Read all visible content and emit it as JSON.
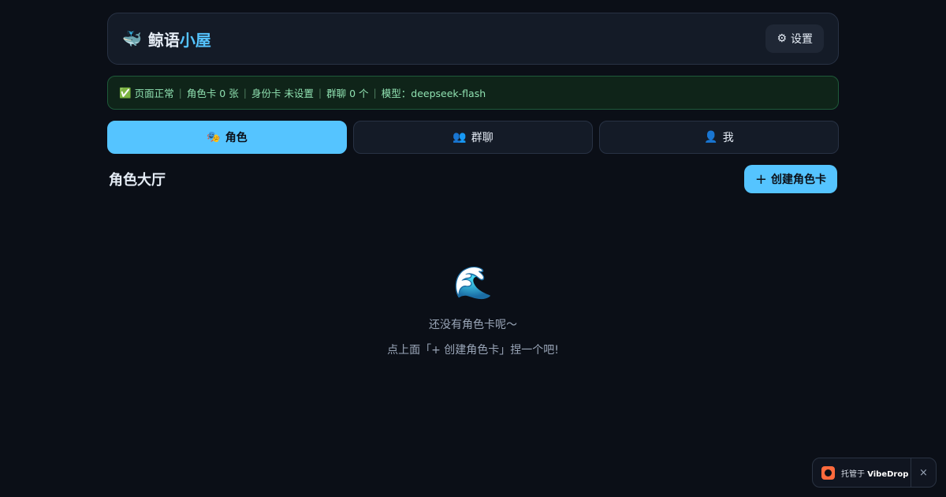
{
  "header": {
    "logo_icon": "🐳",
    "title_part1": "鲸语",
    "title_part2": "小屋",
    "settings_icon": "⚙",
    "settings_label": "设置"
  },
  "status": {
    "check_icon": "✅",
    "items": [
      "页面正常",
      "角色卡 0 张",
      "身份卡 未设置",
      "群聊 0 个",
      "模型：deepseek-flash"
    ]
  },
  "tabs": [
    {
      "icon": "🎭",
      "label": "角色",
      "active": true
    },
    {
      "icon": "👥",
      "label": "群聊",
      "active": false
    },
    {
      "icon": "👤",
      "label": "我",
      "active": false
    }
  ],
  "section": {
    "title": "角色大厅",
    "create_plus": "+",
    "create_label": "创建角色卡"
  },
  "empty": {
    "icon": "🌊",
    "line1": "还没有角色卡呢～",
    "line2": "点上面「+ 创建角色卡」捏一个吧!"
  },
  "badge": {
    "prefix": "托管于 ",
    "brand": "VibeDrop",
    "close": "×"
  },
  "colors": {
    "accent": "#55c4ff",
    "background": "#0b0f17",
    "status_text": "#8fe0b0"
  }
}
